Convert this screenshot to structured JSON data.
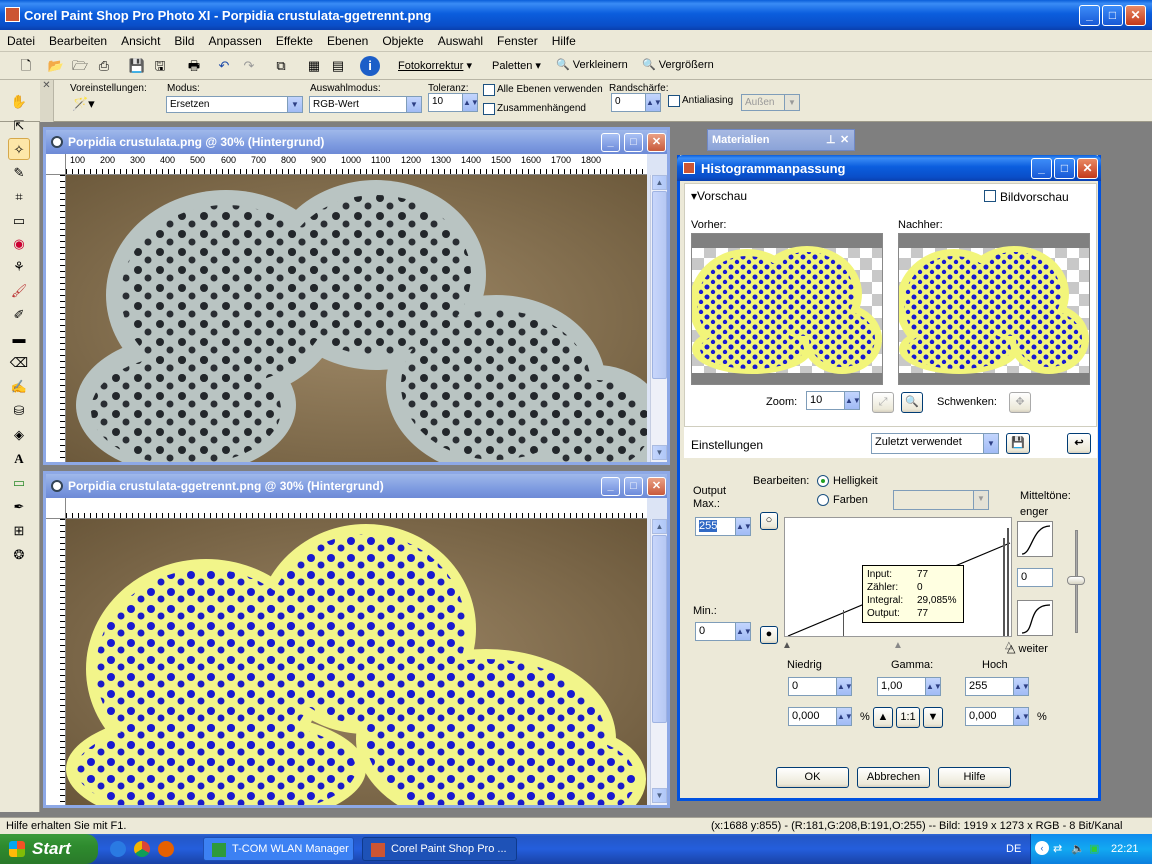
{
  "app": {
    "title": "Corel Paint Shop Pro Photo XI - Porpidia crustulata-ggetrennt.png"
  },
  "menu": [
    "Datei",
    "Bearbeiten",
    "Ansicht",
    "Bild",
    "Anpassen",
    "Effekte",
    "Ebenen",
    "Objekte",
    "Auswahl",
    "Fenster",
    "Hilfe"
  ],
  "toolbar": {
    "fotokorrektur": "Fotokorrektur",
    "paletten": "Paletten",
    "verkleinern": "Verkleinern",
    "vergroessern": "Vergrößern"
  },
  "options": {
    "voreinstellungen_label": "Voreinstellungen:",
    "modus_label": "Modus:",
    "modus_value": "Ersetzen",
    "auswahlmodus_label": "Auswahlmodus:",
    "auswahlmodus_value": "RGB-Wert",
    "toleranz_label": "Toleranz:",
    "toleranz_value": "10",
    "alle_ebenen": "Alle Ebenen verwenden",
    "zusammenhaengend": "Zusammenhängend",
    "randschaerfe_label": "Randschärfe:",
    "randschaerfe_value": "0",
    "antialiasing": "Antialiasing",
    "aussen": "Außen"
  },
  "doc1": {
    "title": "Porpidia crustulata.png @  30% (Hintergrund)",
    "ruler": [
      "100",
      "200",
      "300",
      "400",
      "500",
      "600",
      "700",
      "800",
      "900",
      "1000",
      "1100",
      "1200",
      "1300",
      "1400",
      "1500",
      "1600",
      "1700",
      "1800"
    ]
  },
  "doc2": {
    "title": "Porpidia crustulata-ggetrennt.png @  30% (Hintergrund)"
  },
  "materials": {
    "title": "Materialien"
  },
  "dialog": {
    "title": "Histogrammanpassung",
    "vorschau": "Vorschau",
    "bildvorschau": "Bildvorschau",
    "vorher": "Vorher:",
    "nachher": "Nachher:",
    "zoom_label": "Zoom:",
    "zoom_value": "10",
    "schwenken": "Schwenken:",
    "einstellungen_label": "Einstellungen",
    "einstellungen_value": "Zuletzt verwendet",
    "bearbeiten_label": "Bearbeiten:",
    "helligkeit": "Helligkeit",
    "farben": "Farben",
    "output_label_1": "Output",
    "output_label_2": "Max.:",
    "output_max": "255",
    "min_label": "Min.:",
    "min_value": "0",
    "mitteltoene_label": "Mitteltöne:",
    "enger": "enger",
    "mitteltoene_value": "0",
    "weiter": "weiter",
    "tooltip": {
      "input_label": "Input:",
      "input": "77",
      "zaehler_label": "Zähler:",
      "zaehler": "0",
      "integral_label": "Integral:",
      "integral": "29,085%",
      "output_label": "Output:",
      "output": "77"
    },
    "niedrig_label": "Niedrig",
    "niedrig_value": "0",
    "niedrig_pct": "0,000",
    "gamma_label": "Gamma:",
    "gamma_value": "1,00",
    "gamma_ratio": "1:1",
    "hoch_label": "Hoch",
    "hoch_value": "255",
    "hoch_pct": "0,000",
    "percent": "%",
    "ok": "OK",
    "abbrechen": "Abbrechen",
    "hilfe": "Hilfe"
  },
  "status": {
    "left": "Hilfe erhalten Sie mit F1.",
    "right": "(x:1688 y:855) - (R:181,G:208,B:191,O:255) -- Bild:  1919 x 1273 x RGB - 8 Bit/Kanal"
  },
  "taskbar": {
    "start": "Start",
    "task1": "T-COM WLAN Manager",
    "task2": "Corel Paint Shop Pro ...",
    "lang": "DE",
    "clock": "22:21"
  }
}
